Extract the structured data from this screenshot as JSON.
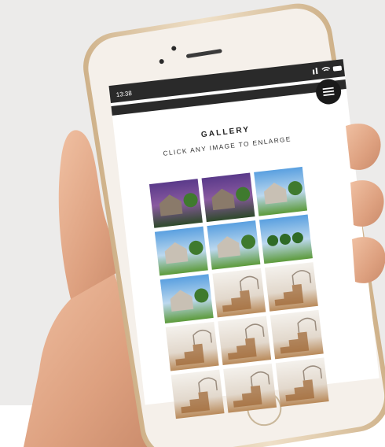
{
  "status_bar": {
    "time": "13:38"
  },
  "gallery": {
    "title": "GALLERY",
    "subtitle": "CLICK ANY IMAGE TO ENLARGE"
  },
  "thumbnails": [
    {
      "subject": "house-exterior-dusk"
    },
    {
      "subject": "house-exterior-dusk"
    },
    {
      "subject": "house-exterior-day"
    },
    {
      "subject": "house-exterior-day"
    },
    {
      "subject": "house-entrance"
    },
    {
      "subject": "lawn-trees"
    },
    {
      "subject": "house-exterior-day"
    },
    {
      "subject": "interior-archway"
    },
    {
      "subject": "interior-staircase"
    },
    {
      "subject": "interior-staircase"
    },
    {
      "subject": "interior-living"
    },
    {
      "subject": "interior-staircase"
    },
    {
      "subject": "interior-room"
    },
    {
      "subject": "interior-room"
    },
    {
      "subject": "interior-room"
    }
  ],
  "colors": {
    "backdrop": "#ecebea",
    "phone_body": "#f2ece4",
    "phone_rim": "#d9c2a0",
    "status_bar": "#2a2a2a",
    "menu_button": "#1a1a1a",
    "skin": "#e0a888"
  }
}
